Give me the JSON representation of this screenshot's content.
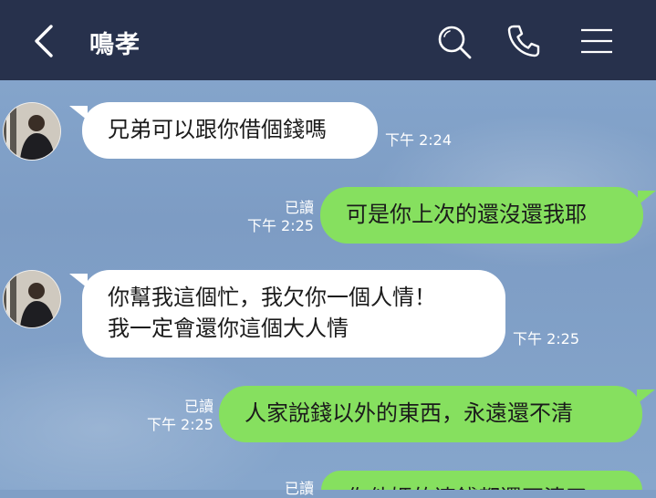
{
  "header": {
    "contact_name": "鳴孝",
    "back_icon": "chevron-left-icon",
    "search_icon": "search-icon",
    "call_icon": "phone-icon",
    "menu_icon": "menu-icon"
  },
  "messages": [
    {
      "side": "left",
      "text": "兄弟可以跟你借個錢嗎",
      "time": "下午 2:24"
    },
    {
      "side": "right",
      "text": "可是你上次的還沒還我耶",
      "read": "已讀",
      "time": "下午 2:25"
    },
    {
      "side": "left",
      "lines": [
        "你幫我這個忙，我欠你一個人情！",
        "我一定會還你這個大人情"
      ],
      "time": "下午 2:25"
    },
    {
      "side": "right",
      "text": "人家說錢以外的東西，永遠還不清",
      "read": "已讀",
      "time": "下午 2:25"
    },
    {
      "side": "right",
      "text": "你他媽的連錢都還不清了",
      "read": "已讀"
    }
  ],
  "colors": {
    "header_bg": "#27314c",
    "chat_bg": "#7f9fc6",
    "incoming_bubble": "#ffffff",
    "outgoing_bubble": "#86e05f",
    "meta_text": "#ffffff"
  }
}
